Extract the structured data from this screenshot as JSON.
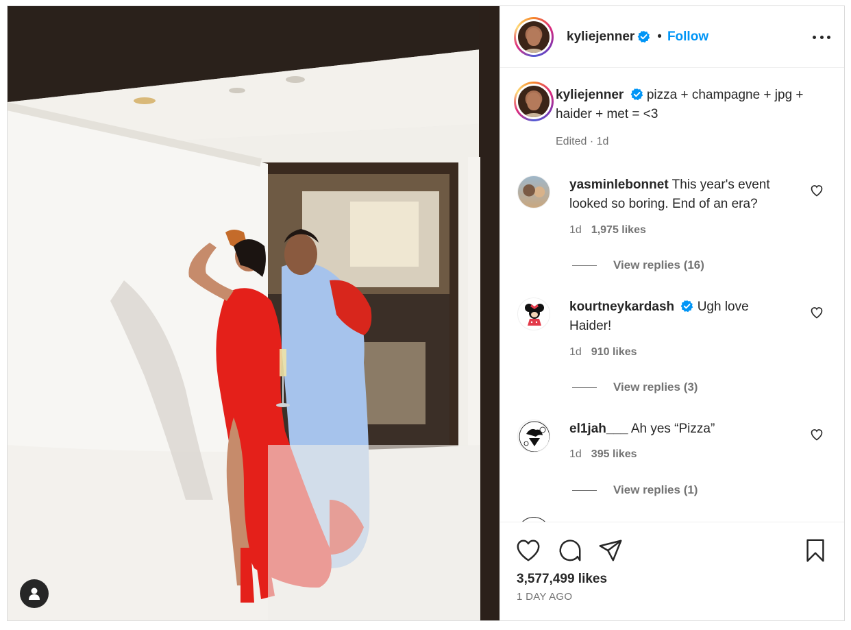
{
  "header": {
    "username": "kyliejenner",
    "separator": "•",
    "follow_label": "Follow"
  },
  "caption": {
    "username": "kyliejenner",
    "text": "pizza + champagne + jpg + haider + met = <3",
    "edited": "Edited",
    "time": "1d"
  },
  "comments": [
    {
      "username": "yasminlebonnet",
      "verified": false,
      "text": "This year's event looked so boring. End of an era?",
      "time": "1d",
      "likes": "1,975 likes",
      "replies": "View replies (16)"
    },
    {
      "username": "kourtneykardash",
      "verified": true,
      "text": "Ugh love Haider!",
      "time": "1d",
      "likes": "910 likes",
      "replies": "View replies (3)"
    },
    {
      "username": "el1jah___",
      "verified": false,
      "text": "Ah yes “Pizza”",
      "time": "1d",
      "likes": "395 likes",
      "replies": "View replies (1)"
    }
  ],
  "actions": {
    "likes": "3,577,499 likes",
    "date": "1 DAY AGO"
  },
  "icons": {
    "verified": "verified-badge-icon",
    "more": "more-options-icon",
    "like": "heart-icon",
    "comment": "comment-icon",
    "share": "paper-plane-icon",
    "save": "bookmark-icon",
    "user_tag": "person-icon"
  },
  "colors": {
    "accent": "#0095f6",
    "text": "#262626",
    "secondary": "#737373",
    "verified": "#0095f6"
  }
}
